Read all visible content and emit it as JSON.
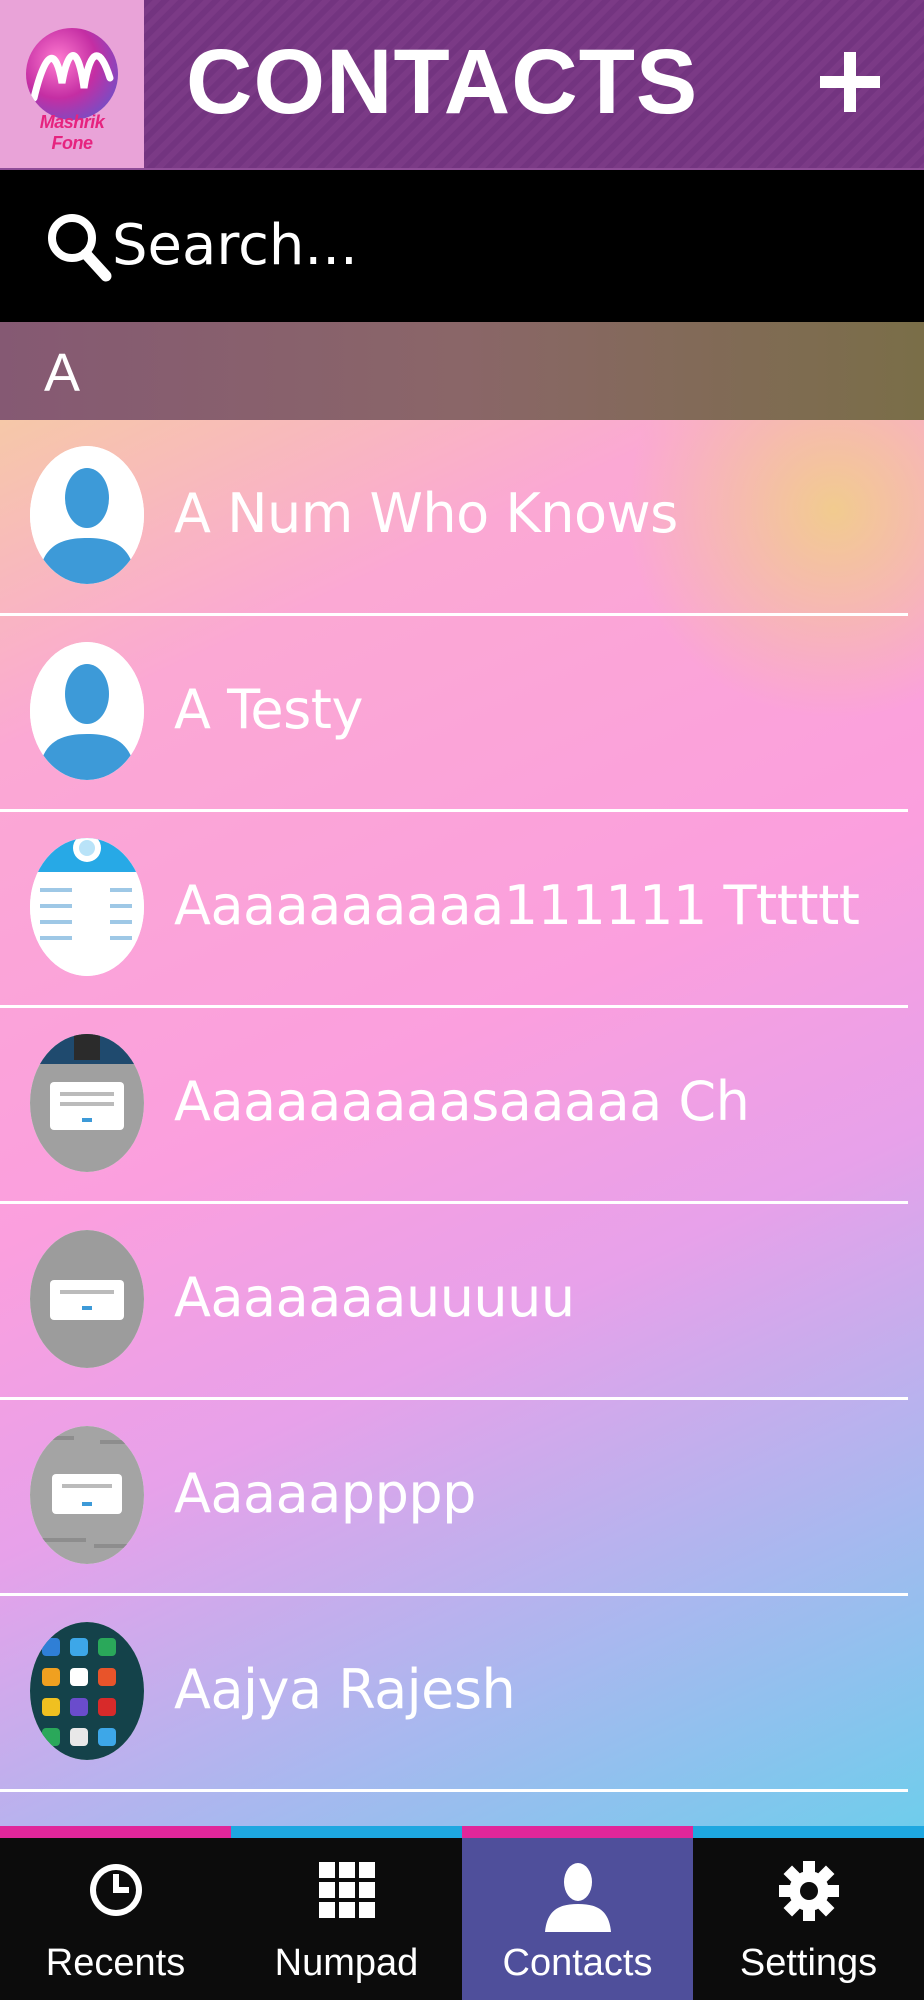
{
  "header": {
    "logo_text": "Mashrik Fone",
    "title": "CONTACTS",
    "add_button": "+"
  },
  "search": {
    "placeholder": "Search..."
  },
  "section": {
    "letter": "A"
  },
  "contacts": [
    {
      "name": "A Num Who Knows",
      "avatar": "default-user"
    },
    {
      "name": "A Testy",
      "avatar": "default-user"
    },
    {
      "name": "Aaaaaaaaaa111111 Tttttt",
      "avatar": "screenshot-photo"
    },
    {
      "name": "Aaaaaaaaasaaaaa Ch",
      "avatar": "dialog-photo"
    },
    {
      "name": "Aaaaaaauuuuu",
      "avatar": "dialog-photo"
    },
    {
      "name": "Aaaaapppp",
      "avatar": "dialog-photo"
    },
    {
      "name": "Aajya Rajesh",
      "avatar": "homescreen-photo"
    }
  ],
  "nav": [
    {
      "label": "Recents",
      "icon": "clock-icon",
      "stripe": "#e0269a",
      "active": false
    },
    {
      "label": "Numpad",
      "icon": "grid-icon",
      "stripe": "#1ea7e0",
      "active": false
    },
    {
      "label": "Contacts",
      "icon": "person-icon",
      "stripe": "#e0269a",
      "active": true
    },
    {
      "label": "Settings",
      "icon": "gear-icon",
      "stripe": "#1ea7e0",
      "active": false
    }
  ],
  "colors": {
    "header_bg": "#7b3a86",
    "logo_bg": "#e9a3d8",
    "search_bg": "#000000",
    "nav_bg": "#0c0c0c",
    "nav_active_bg": "#4f4f9b",
    "default_avatar_blue": "#3d9ad8"
  }
}
